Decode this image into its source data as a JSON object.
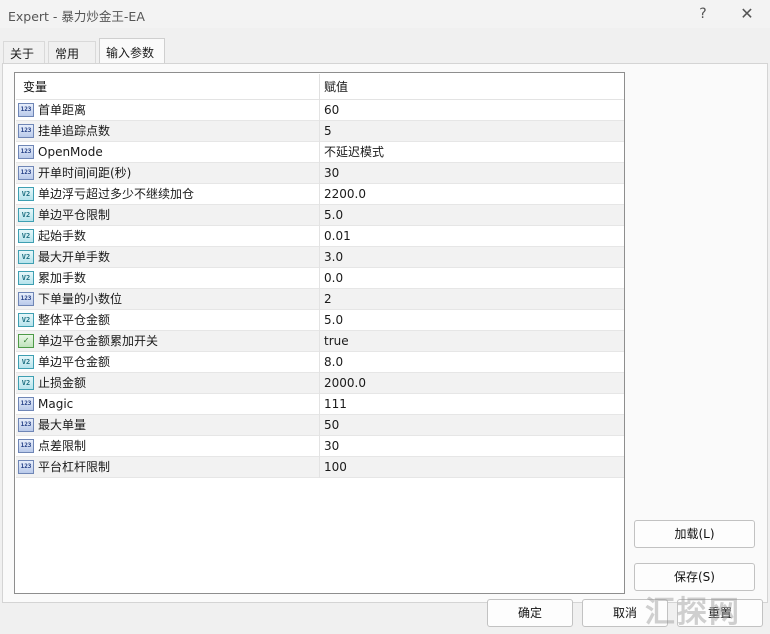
{
  "window": {
    "title": "Expert - 暴力炒金王-EA",
    "help_glyph": "?",
    "close_glyph": "✕"
  },
  "tabs": [
    {
      "label": "关于"
    },
    {
      "label": "常用"
    },
    {
      "label": "输入参数"
    }
  ],
  "grid": {
    "headers": {
      "name": "变量",
      "value": "赋值"
    },
    "rows": [
      {
        "icon": "123",
        "type": "int",
        "name": "首单距离",
        "value": "60"
      },
      {
        "icon": "123",
        "type": "int",
        "name": "挂单追踪点数",
        "value": "5"
      },
      {
        "icon": "123",
        "type": "int",
        "name": "OpenMode",
        "value": "不延迟模式"
      },
      {
        "icon": "123",
        "type": "int",
        "name": "开单时间间距(秒)",
        "value": "30"
      },
      {
        "icon": "V2",
        "type": "double",
        "name": "单边浮亏超过多少不继续加仓",
        "value": "2200.0"
      },
      {
        "icon": "V2",
        "type": "double",
        "name": "单边平仓限制",
        "value": "5.0"
      },
      {
        "icon": "V2",
        "type": "double",
        "name": "起始手数",
        "value": "0.01"
      },
      {
        "icon": "V2",
        "type": "double",
        "name": "最大开单手数",
        "value": "3.0"
      },
      {
        "icon": "V2",
        "type": "double",
        "name": "累加手数",
        "value": "0.0"
      },
      {
        "icon": "123",
        "type": "int",
        "name": "下单量的小数位",
        "value": "2"
      },
      {
        "icon": "V2",
        "type": "double",
        "name": "整体平仓金额",
        "value": "5.0"
      },
      {
        "icon": "✓",
        "type": "bool",
        "name": "单边平仓金额累加开关",
        "value": "true"
      },
      {
        "icon": "V2",
        "type": "double",
        "name": "单边平仓金额",
        "value": "8.0"
      },
      {
        "icon": "V2",
        "type": "double",
        "name": "止损金额",
        "value": "2000.0"
      },
      {
        "icon": "123",
        "type": "int",
        "name": "Magic",
        "value": "111"
      },
      {
        "icon": "123",
        "type": "int",
        "name": "最大单量",
        "value": "50"
      },
      {
        "icon": "123",
        "type": "int",
        "name": "点差限制",
        "value": "30"
      },
      {
        "icon": "123",
        "type": "int",
        "name": "平台杠杆限制",
        "value": "100"
      }
    ]
  },
  "buttons": {
    "load": "加载(L)",
    "save": "保存(S)",
    "ok": "确定",
    "cancel": "取消",
    "reset": "重置"
  },
  "watermark": {
    "text": "汇探网"
  }
}
